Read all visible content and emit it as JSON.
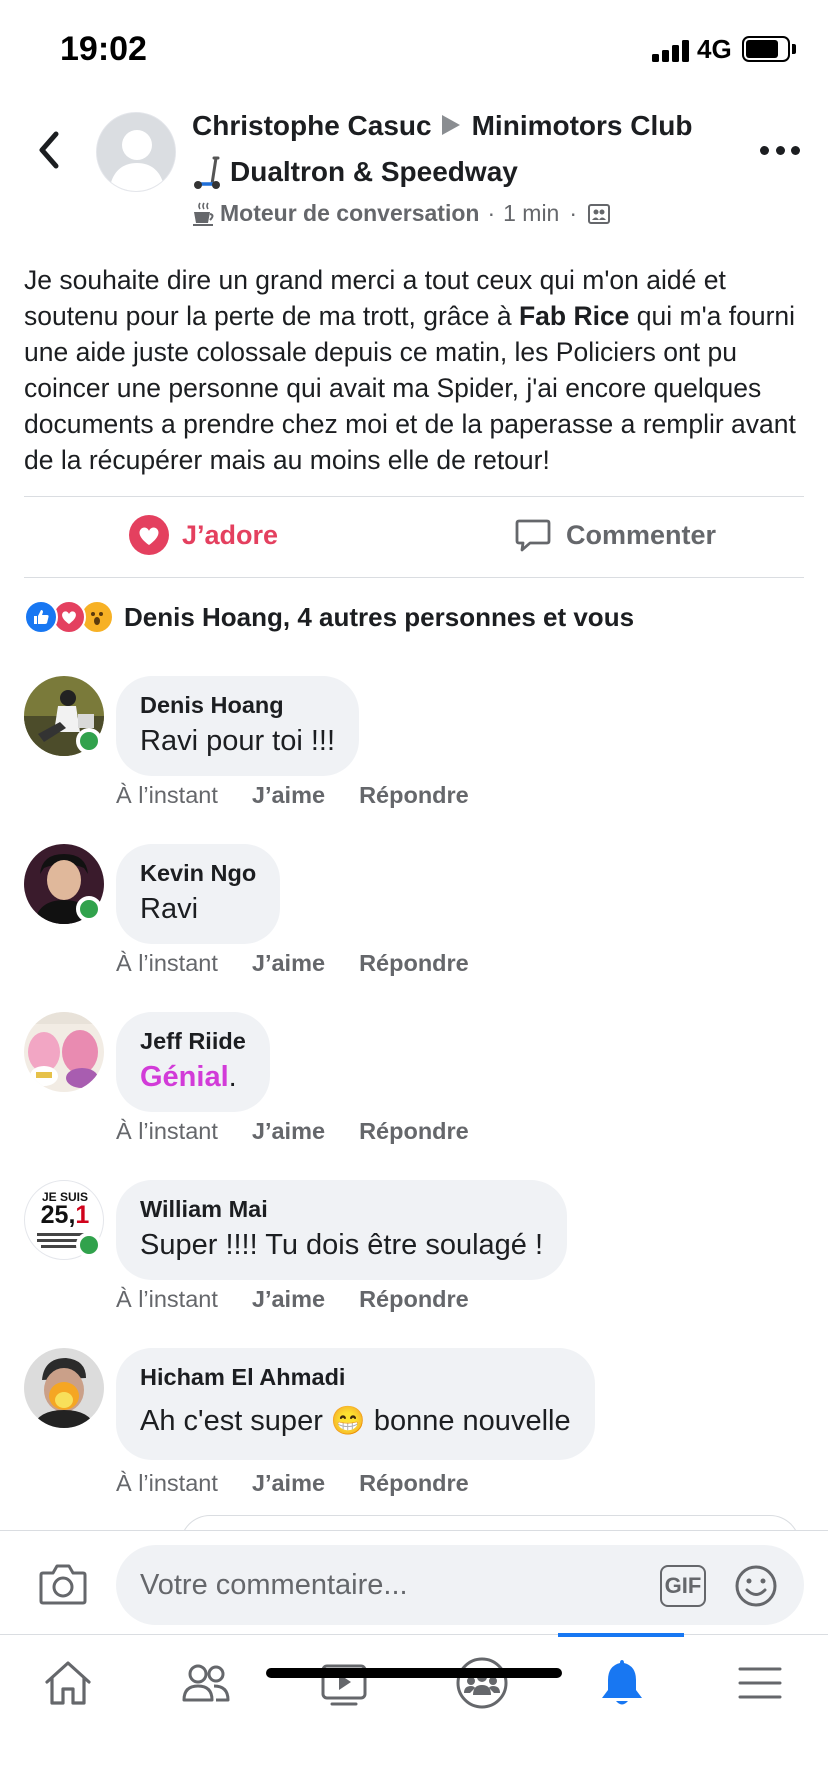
{
  "status_bar": {
    "time": "19:02",
    "network": "4G"
  },
  "post": {
    "author": "Christophe Casuc",
    "group_line1": "Minimotors  Club",
    "group_line2": "Dualtron & Speedway",
    "badge": "Moteur de conversation",
    "time": "1 min",
    "body_part1": "Je souhaite dire un grand merci a tout ceux qui m'on aidé et soutenu pour la perte de ma trott, grâce à ",
    "mention": "Fab Rice",
    "body_part2": " qui m'a fourni une aide juste colossale depuis ce matin, les Policiers ont pu coincer une personne qui avait ma Spider, j'ai encore quelques documents a prendre chez moi et de la paperasse a remplir  avant de la récupérer mais au moins elle de retour!"
  },
  "actions": {
    "like": "J’adore",
    "comment": "Commenter"
  },
  "reactions": {
    "summary": "Denis Hoang, 4 autres personnes et vous"
  },
  "comments": [
    {
      "name": "Denis Hoang",
      "text": "Ravi pour toi !!!",
      "time": "À l’instant",
      "like": "J’aime",
      "reply": "Répondre"
    },
    {
      "name": "Kevin Ngo",
      "text": "Ravi",
      "time": "À l’instant",
      "like": "J’aime",
      "reply": "Répondre"
    },
    {
      "name": "Jeff Riide",
      "text": "Génial",
      "text_suffix": ".",
      "time": "À l’instant",
      "like": "J’aime",
      "reply": "Répondre"
    },
    {
      "name": "William Mai",
      "text": "Super !!!! Tu dois être soulagé !",
      "avatar_text_top": "JE SUIS",
      "avatar_text_main": "25,",
      "avatar_text_accent": "1",
      "time": "À l’instant",
      "like": "J’aime",
      "reply": "Répondre"
    },
    {
      "name": "Hicham El Ahmadi",
      "text_part1": "Ah c'est super ",
      "emoji": "😁",
      "text_part2": " bonne nouvelle",
      "time": "À l’instant",
      "like": "J’aime",
      "reply": "Répondre"
    }
  ],
  "composer": {
    "placeholder": "Votre commentaire...",
    "gif": "GIF"
  },
  "colors": {
    "accent": "#1877f2",
    "love": "#e4405f",
    "online": "#31a24c",
    "bubble": "#f0f2f5",
    "genial": "#d23bd8"
  }
}
